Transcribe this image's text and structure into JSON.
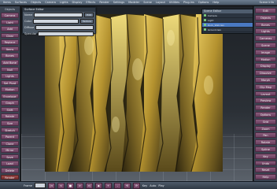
{
  "app": {
    "menu": [
      "Items",
      "Surfaces",
      "Objects",
      "Camera",
      "Lights",
      "Display",
      "Effects",
      "Render",
      "Settings",
      "Modeler",
      "Scene",
      "Layout",
      "Utilities",
      "Plug-ins",
      "Options",
      "Help"
    ],
    "menu_right": "Scene Info"
  },
  "left_panel": {
    "header": "Objects",
    "buttons": [
      "Camera",
      "Light",
      "Add",
      "Clear",
      "Replace",
      "Items",
      "Bones",
      "Add Bone",
      "Null",
      "Lights",
      "Set Pivot",
      "Motion",
      "Envelope",
      "Graph",
      "Shift",
      "Rotate",
      "Size",
      "Stretch",
      "Parent",
      "Clone",
      "Mirror",
      "Save",
      "Load",
      "Delete",
      "Render"
    ]
  },
  "right_panel": {
    "buttons": [
      "Edit",
      "Objects",
      "Bones",
      "Lights",
      "Cameras",
      "Scene",
      "Image",
      "Motion",
      "Display",
      "Dissolve",
      "Morph",
      "Clip Map",
      "Layout",
      "Preview",
      "Render",
      "Options",
      "Grid",
      "Zoom",
      "Pan",
      "Rotate",
      "Spline",
      "Key",
      "Undo",
      "Reset",
      "Help"
    ]
  },
  "surface_dialog": {
    "title": "Surface Editor",
    "rows": [
      {
        "label": "Name",
        "value": ""
      },
      {
        "label": "Color",
        "value": ""
      },
      {
        "label": "Diffuse",
        "value": ""
      },
      {
        "label": "Specular",
        "value": ""
      }
    ],
    "buttons": [
      "Edit",
      "Texture"
    ]
  },
  "scene_panel": {
    "title": "Scene Editor",
    "rows": [
      "Camera",
      "Light",
      "Rock_Wall.lwo",
      "Ground.lwo"
    ]
  },
  "timeline": {
    "buttons": [
      "|<",
      "<",
      "■",
      ">",
      ">|",
      "◆",
      "+",
      "-",
      "⟲",
      "⟳"
    ],
    "labels": [
      "Frame",
      "Key",
      "Auto",
      "Play"
    ]
  },
  "colors": {
    "viewport_bg": "#2b3036",
    "panel_bg": "#3a4350",
    "button_purple": "#7a4c6e",
    "menubar": "#5b6b7d",
    "rock_gold": "#c8a33a"
  }
}
